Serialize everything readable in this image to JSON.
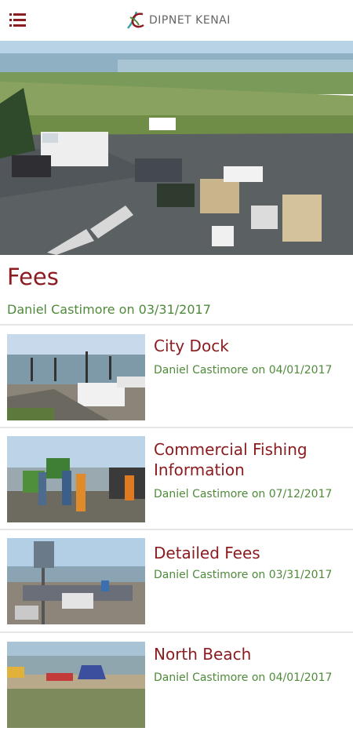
{
  "header": {
    "app_title": "DIPNET KENAI",
    "menu_icon": "hamburger-menu-icon",
    "brand_color": "#8b1c20"
  },
  "article": {
    "title": "Fees",
    "author_line": "Daniel Castimore on 03/31/2017"
  },
  "related": [
    {
      "title": "City Dock",
      "meta": "Daniel Castimore on 04/01/2017"
    },
    {
      "title": "Commercial Fishing Information",
      "meta": "Daniel Castimore on 07/12/2017"
    },
    {
      "title": "Detailed Fees",
      "meta": "Daniel Castimore on 03/31/2017"
    },
    {
      "title": "North Beach",
      "meta": "Daniel Castimore on 04/01/2017"
    }
  ],
  "colors": {
    "title_red": "#8b1c20",
    "meta_green": "#4f8a3a"
  }
}
